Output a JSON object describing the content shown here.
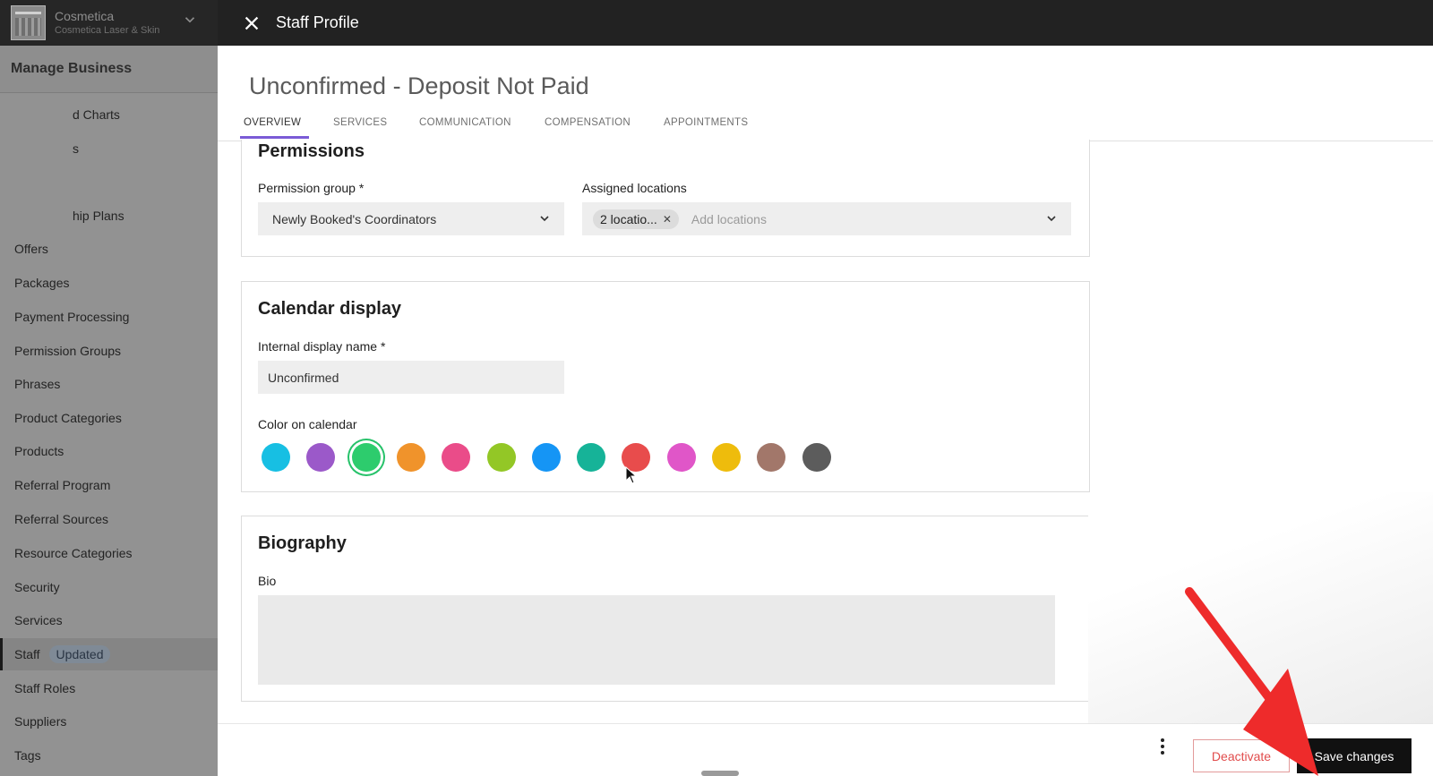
{
  "business": {
    "name": "Cosmetica",
    "subtitle": "Cosmetica Laser & Skin"
  },
  "sidebar": {
    "heading": "Manage Business",
    "items": [
      {
        "label": "d Charts",
        "cut": true
      },
      {
        "label": "s",
        "cut": true
      },
      {
        "label": "",
        "cut": true
      },
      {
        "label": "hip Plans",
        "cut": true
      },
      {
        "label": "Offers"
      },
      {
        "label": "Packages"
      },
      {
        "label": "Payment Processing"
      },
      {
        "label": "Permission Groups"
      },
      {
        "label": "Phrases"
      },
      {
        "label": "Product Categories"
      },
      {
        "label": "Products"
      },
      {
        "label": "Referral Program"
      },
      {
        "label": "Referral Sources"
      },
      {
        "label": "Resource Categories"
      },
      {
        "label": "Security"
      },
      {
        "label": "Services"
      },
      {
        "label": "Staff",
        "active": true,
        "badge": "Updated"
      },
      {
        "label": "Staff Roles"
      },
      {
        "label": "Suppliers"
      },
      {
        "label": "Tags"
      }
    ]
  },
  "topbar": {
    "title": "Staff Profile",
    "close_icon": "close-icon"
  },
  "profile": {
    "name": "Unconfirmed - Deposit Not Paid",
    "tabs": [
      {
        "label": "OVERVIEW",
        "active": true
      },
      {
        "label": "SERVICES"
      },
      {
        "label": "COMMUNICATION"
      },
      {
        "label": "COMPENSATION"
      },
      {
        "label": "APPOINTMENTS"
      }
    ]
  },
  "permissions": {
    "heading": "Permissions",
    "group_label": "Permission group *",
    "group_value": "Newly Booked's Coordinators",
    "locations_label": "Assigned locations",
    "locations_chip": "2 locatio...",
    "locations_placeholder": "Add locations"
  },
  "calendar": {
    "heading": "Calendar display",
    "display_name_label": "Internal display name *",
    "display_name_value": "Unconfirmed",
    "color_label": "Color on calendar",
    "colors": [
      "#17bfe3",
      "#9b59c9",
      "#2dcc6d",
      "#f0932b",
      "#ea4c89",
      "#93c726",
      "#1595f5",
      "#16b398",
      "#e84c4c",
      "#e056c8",
      "#eebc0c",
      "#a2776a",
      "#5c5c5c"
    ],
    "selected_color": "#2dcc6d"
  },
  "biography": {
    "heading": "Biography",
    "bio_label": "Bio",
    "bio_value": ""
  },
  "footer": {
    "deactivate_label": "Deactivate",
    "save_label": "Save changes"
  },
  "colors": {
    "accent": "#7b5bd6",
    "danger": "#e14c4c",
    "annotation_arrow": "#ee2b2b"
  }
}
